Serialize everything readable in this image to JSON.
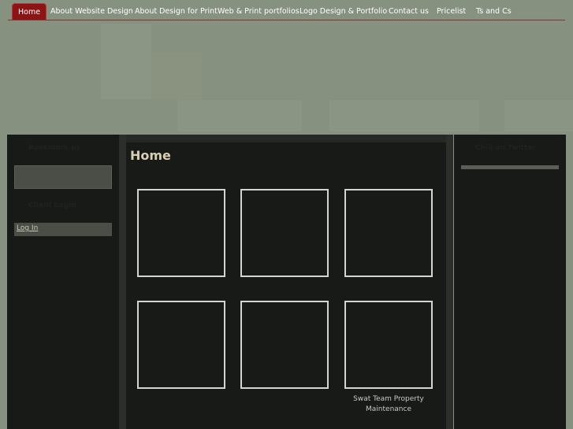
{
  "nav": {
    "items": [
      {
        "label": "Home",
        "active": true
      },
      {
        "label": "About Website Design",
        "active": false
      },
      {
        "label": "About Design for Print",
        "active": false
      },
      {
        "label": "Web & Print portfolios",
        "active": false
      },
      {
        "label": "Logo Design & Portfolio",
        "active": false
      },
      {
        "label": "Contact us",
        "active": false
      },
      {
        "label": "Pricelist",
        "active": false
      },
      {
        "label": "Ts and Cs",
        "active": false
      }
    ]
  },
  "left_sidebar": {
    "bookmark_title": "Bookmark us",
    "client_login_title": "Client Login",
    "login_link": "Log In"
  },
  "right_sidebar": {
    "twitter_title": "Chill on Twitter"
  },
  "main": {
    "title": "Home",
    "thumb_caption": "Swat Team Property Maintenance"
  },
  "colors": {
    "background": "#87917f",
    "panel": "#181a17",
    "nav_active": "#8c1414",
    "title": "#d8ceb2"
  }
}
